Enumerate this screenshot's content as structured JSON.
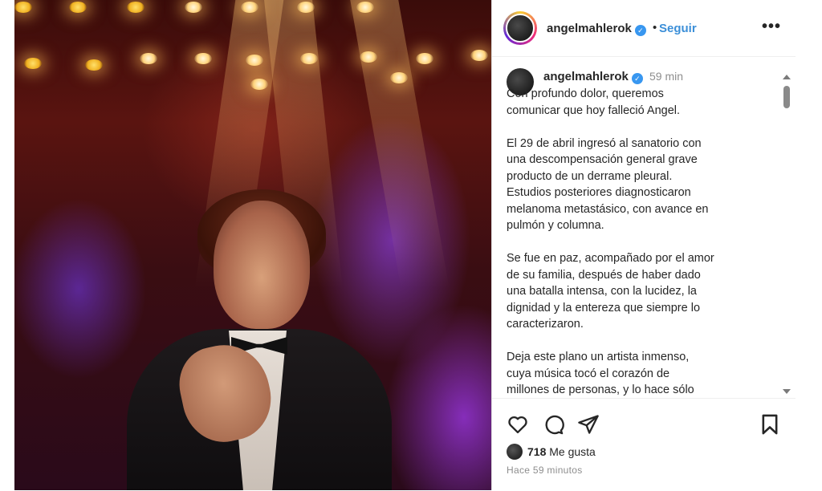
{
  "post": {
    "username": "angelmahlerok",
    "follow_label": "Seguir",
    "separator": "•",
    "more_label": "•••",
    "verified_mark": "✓",
    "caption_time": "59 min",
    "caption_text": "Con profundo dolor, queremos\ncomunicar que hoy falleció Angel.\n\nEl 29 de abril ingresó al sanatorio con\nuna descompensación general grave\nproducto de un derrame pleural.\nEstudios posteriores diagnosticaron\nmelanoma metastásico, con avance en\npulmón y columna.\n\nSe fue en paz, acompañado por el amor\nde su familia, después de haber dado\nuna batalla intensa, con la lucidez, la\ndignidad y la entereza que siempre lo\ncaracterizaron.\n\nDeja este plano un artista inmenso,\ncuya música tocó el corazón de\nmillones de personas, y lo hace sólo",
    "likes_count": "718",
    "likes_label": "Me gusta",
    "posted_ago": "Hace 59 minutos"
  },
  "icons": {
    "like": "heart-icon",
    "comment": "comment-icon",
    "share": "share-icon",
    "save": "bookmark-icon",
    "more": "more-icon",
    "verified": "verified-badge-icon"
  },
  "colors": {
    "follow": "#3c8fd8",
    "verified": "#3897f0",
    "muted": "#8e8e8e"
  }
}
